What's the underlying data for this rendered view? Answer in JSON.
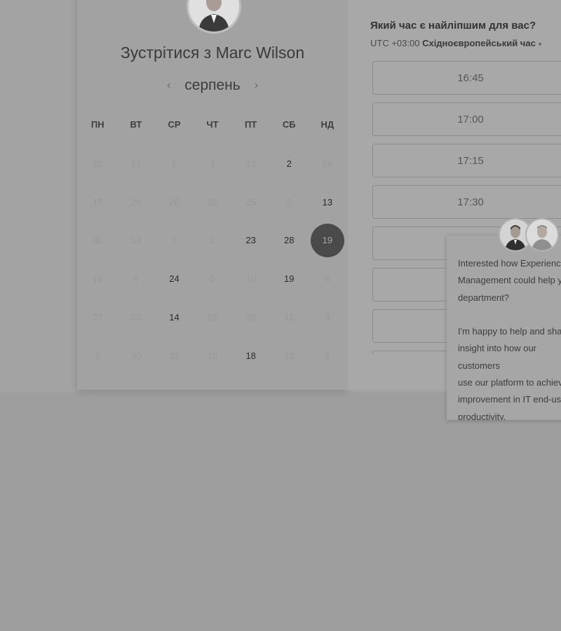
{
  "meeting": {
    "title": "Зустрітися з Marc Wilson"
  },
  "calendar": {
    "month": "серпень",
    "prev_icon": "‹",
    "next_icon": "›",
    "weekdays": [
      "ПН",
      "ВТ",
      "СР",
      "ЧТ",
      "ПТ",
      "СБ",
      "НД"
    ],
    "weeks": [
      [
        {
          "d": "20",
          "s": "muted"
        },
        {
          "d": "22",
          "s": "muted"
        },
        {
          "d": "5",
          "s": "muted"
        },
        {
          "d": "1",
          "s": "muted"
        },
        {
          "d": "23",
          "s": "muted"
        },
        {
          "d": "2",
          "s": "active"
        },
        {
          "d": "26",
          "s": "muted"
        }
      ],
      [
        {
          "d": "10",
          "s": "muted"
        },
        {
          "d": "20",
          "s": "muted"
        },
        {
          "d": "26",
          "s": "muted"
        },
        {
          "d": "22",
          "s": "muted"
        },
        {
          "d": "25",
          "s": "muted"
        },
        {
          "d": "5",
          "s": "muted"
        },
        {
          "d": "13",
          "s": "active"
        }
      ],
      [
        {
          "d": "30",
          "s": "muted"
        },
        {
          "d": "13",
          "s": "muted"
        },
        {
          "d": "7",
          "s": "muted"
        },
        {
          "d": "2",
          "s": "muted"
        },
        {
          "d": "23",
          "s": "active"
        },
        {
          "d": "28",
          "s": "active"
        },
        {
          "d": "19",
          "s": "selected"
        }
      ],
      [
        {
          "d": "16",
          "s": "muted"
        },
        {
          "d": "6",
          "s": "muted"
        },
        {
          "d": "24",
          "s": "active"
        },
        {
          "d": "5",
          "s": "muted"
        },
        {
          "d": "10",
          "s": "muted"
        },
        {
          "d": "19",
          "s": "active"
        },
        {
          "d": "6",
          "s": "muted"
        }
      ],
      [
        {
          "d": "27",
          "s": "muted"
        },
        {
          "d": "23",
          "s": "muted"
        },
        {
          "d": "14",
          "s": "active"
        },
        {
          "d": "22",
          "s": "muted"
        },
        {
          "d": "20",
          "s": "muted"
        },
        {
          "d": "11",
          "s": "muted"
        },
        {
          "d": "9",
          "s": "muted"
        }
      ],
      [
        {
          "d": "6",
          "s": "muted"
        },
        {
          "d": "30",
          "s": "muted"
        },
        {
          "d": "22",
          "s": "muted"
        },
        {
          "d": "18",
          "s": "muted"
        },
        {
          "d": "18",
          "s": "active"
        },
        {
          "d": "13",
          "s": "muted"
        },
        {
          "d": "6",
          "s": "muted"
        }
      ]
    ]
  },
  "times": {
    "question": "Який час є найліпшим для вас?",
    "tz_prefix": "UTC +03:00",
    "tz_name": "Східноєвропейський час",
    "tz_caret": "▾",
    "slots": [
      "16:45",
      "17:00",
      "17:15",
      "17:30",
      "",
      "",
      "",
      ""
    ]
  },
  "chat": {
    "message": "Interested how Experience\nManagement could help your\ndepartment?\n\nI'm happy to help and share\ninsight into how our customers\nuse our platform to achieve\nimprovement in IT end-user\nproductivity."
  },
  "colors": {
    "overlay_bg": "#9e9e9e",
    "selected_day": "#4a4a4a"
  }
}
